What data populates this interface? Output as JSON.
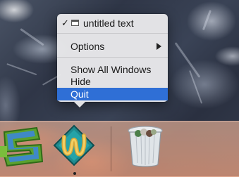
{
  "context_menu": {
    "items": [
      {
        "label": "untitled text",
        "checked": true
      },
      {
        "label": "Options"
      },
      {
        "label": "Show All Windows"
      },
      {
        "label": "Hide"
      },
      {
        "label": "Quit",
        "selected": true
      }
    ],
    "check_glyph": "✓",
    "selection_color": "#2f6fd6"
  },
  "dock": {
    "apps": [
      {
        "icon": "stylized-s-app-icon"
      },
      {
        "icon": "textwrangler-app-icon",
        "running": true
      },
      {
        "icon": "trash-icon"
      }
    ]
  }
}
